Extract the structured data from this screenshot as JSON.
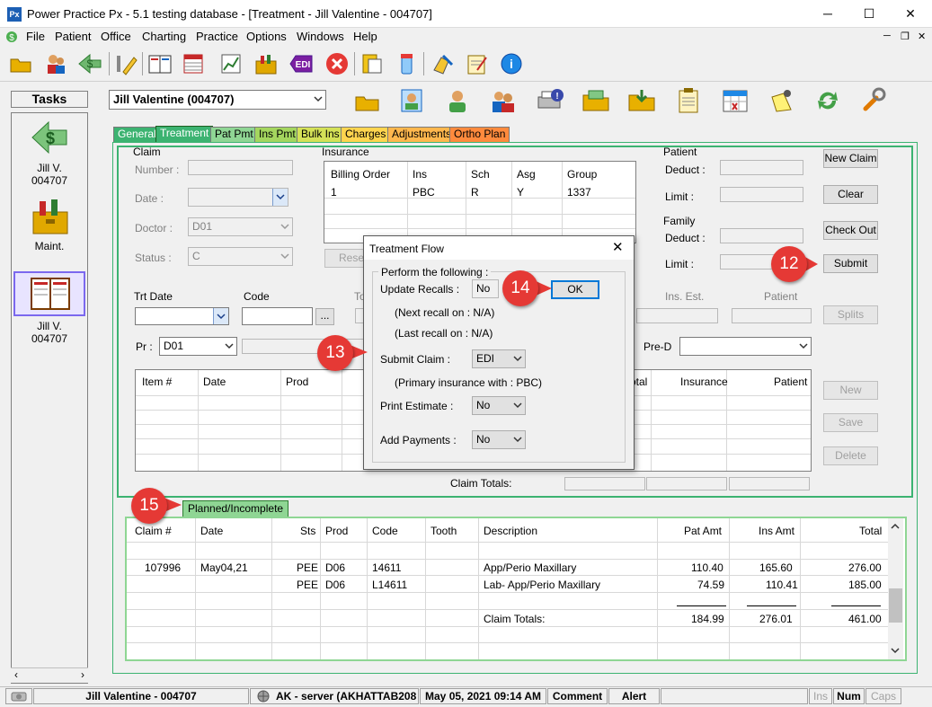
{
  "window": {
    "title": "Power Practice Px - 5.1 testing database - [Treatment - Jill Valentine - 004707]",
    "app_icon": "Px"
  },
  "menu": [
    "File",
    "Patient",
    "Office",
    "Charting",
    "Practice",
    "Options",
    "Windows",
    "Help"
  ],
  "tasks": {
    "header": "Tasks",
    "items": [
      {
        "label1": "Jill V.",
        "label2": "004707",
        "icon": "dollar-arrow-icon"
      },
      {
        "label1": "Maint.",
        "label2": "",
        "icon": "toolbox-icon"
      },
      {
        "label1": "Jill V.",
        "label2": "004707",
        "icon": "book-icon"
      }
    ]
  },
  "patient_select": "Jill Valentine (004707)",
  "tabs": [
    "General",
    "Treatment",
    "Pat Pmt",
    "Ins Pmt",
    "Bulk Ins",
    "Charges",
    "Adjustments",
    "Ortho Plan"
  ],
  "claim": {
    "title": "Claim",
    "number_label": "Number :",
    "date_label": "Date :",
    "doctor_label": "Doctor :",
    "doctor_value": "D01",
    "status_label": "Status :",
    "status_value": "C"
  },
  "insurance": {
    "title": "Insurance",
    "headers": [
      "Billing Order",
      "Ins",
      "Sch",
      "Asg",
      "Group"
    ],
    "rows": [
      [
        "1",
        "PBC",
        "R",
        "Y",
        "1337"
      ]
    ],
    "reset_label": "Rese"
  },
  "patient": {
    "title": "Patient",
    "deduct_label": "Deduct :",
    "limit_label": "Limit :"
  },
  "family": {
    "title": "Family",
    "deduct_label": "Deduct :",
    "limit_label": "Limit :"
  },
  "buttons": {
    "new_claim": "New Claim",
    "clear": "Clear",
    "check_out": "Check Out",
    "submit": "Submit",
    "splits": "Splits",
    "new": "New",
    "save": "Save",
    "delete": "Delete"
  },
  "trt": {
    "date_label": "Trt Date",
    "code_label": "Code",
    "to_label": "To",
    "ins_est_label": "Ins. Est.",
    "patient_label": "Patient",
    "pr_label": "Pr :",
    "pr_value": "D01",
    "pred_label": "Pre-D"
  },
  "items_table": {
    "headers": [
      "Item #",
      "Date",
      "Prod",
      "otal",
      "Insurance",
      "Patient"
    ]
  },
  "claim_totals_label": "Claim Totals:",
  "dialog": {
    "title": "Treatment Flow",
    "group_label": "Perform the following :",
    "update_recalls_label": "Update Recalls :",
    "update_recalls_value": "No",
    "ok_label": "OK",
    "next_recall": "(Next recall on : N/A)",
    "last_recall": "(Last recall on : N/A)",
    "submit_claim_label": "Submit Claim :",
    "submit_claim_value": "EDI",
    "primary_ins": "(Primary insurance with : PBC)",
    "print_estimate_label": "Print Estimate :",
    "print_estimate_value": "No",
    "add_payments_label": "Add Payments :",
    "add_payments_value": "No"
  },
  "planned": {
    "tab_label": "Planned/Incomplete",
    "headers": [
      "Claim #",
      "Date",
      "Sts",
      "Prod",
      "Code",
      "Tooth",
      "Description",
      "Pat Amt",
      "Ins Amt",
      "Total"
    ],
    "rows": [
      [
        "107996",
        "May04,21",
        "PEE",
        "D06",
        "14611",
        "",
        "App/Perio Maxillary",
        "110.40",
        "165.60",
        "276.00"
      ],
      [
        "",
        "",
        "PEE",
        "D06",
        "L14611",
        "",
        "Lab- App/Perio Maxillary",
        "74.59",
        "110.41",
        "185.00"
      ]
    ],
    "totals_label": "Claim Totals:",
    "totals": [
      "184.99",
      "276.01",
      "461.00"
    ]
  },
  "badges": [
    "12",
    "13",
    "14",
    "15"
  ],
  "status": {
    "patient": "Jill Valentine - 004707",
    "server": "AK - server (AKHATTAB208",
    "datetime": "May 05, 2021 09:14 AM",
    "comment": "Comment",
    "alert": "Alert",
    "ins": "Ins",
    "num": "Num",
    "caps": "Caps"
  }
}
